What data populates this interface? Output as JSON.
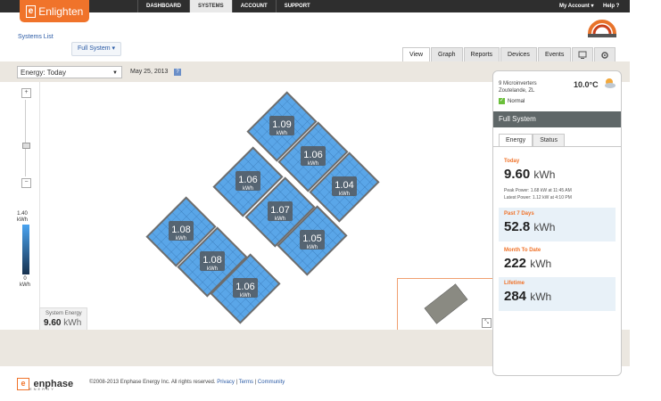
{
  "header": {
    "logo_text": "Enlighten",
    "logo_bracket": "e",
    "nav": [
      "DASHBOARD",
      "SYSTEMS",
      "ACCOUNT",
      "SUPPORT"
    ],
    "active_nav": "SYSTEMS",
    "my_account": "My Account ▾",
    "help": "Help ?"
  },
  "systems_list": "Systems List",
  "full_system_dropdown": "Full System ▾",
  "view_tabs": [
    "View",
    "Graph",
    "Reports",
    "Devices",
    "Events"
  ],
  "active_view_tab": "View",
  "toolbar": {
    "energy_select": "Energy: Today",
    "date": "May 25, 2013",
    "help_button": "?"
  },
  "scale": {
    "max": "1.40",
    "max_unit": "kWh",
    "min": "0",
    "min_unit": "kWh"
  },
  "panels": [
    {
      "value": "1.09",
      "unit": "kWh"
    },
    {
      "value": "1.06",
      "unit": "kWh"
    },
    {
      "value": "1.06",
      "unit": "kWh"
    },
    {
      "value": "1.04",
      "unit": "kWh"
    },
    {
      "value": "1.07",
      "unit": "kWh"
    },
    {
      "value": "1.08",
      "unit": "kWh"
    },
    {
      "value": "1.05",
      "unit": "kWh"
    },
    {
      "value": "1.08",
      "unit": "kWh"
    },
    {
      "value": "1.06",
      "unit": "kWh"
    }
  ],
  "system_energy": {
    "label": "System Energy",
    "value": "9.60",
    "unit": "kWh"
  },
  "sidebar": {
    "location_line1": "9 Microinverters",
    "location_line2": "Zoutelande, ZL",
    "temperature": "10.0°C",
    "status": "Normal",
    "title": "Full System",
    "tabs": [
      "Energy",
      "Status"
    ],
    "active_tab": "Energy",
    "cards": [
      {
        "label": "Today",
        "value": "9.60",
        "unit": "kWh",
        "peak": "Peak Power: 1.68 kW at 11:45 AM",
        "latest": "Latest Power: 1.12 kW at 4:10 PM"
      },
      {
        "label": "Past 7 Days",
        "value": "52.8",
        "unit": "kWh"
      },
      {
        "label": "Month To Date",
        "value": "222",
        "unit": "kWh"
      },
      {
        "label": "Lifetime",
        "value": "284",
        "unit": "kWh"
      }
    ]
  },
  "footer": {
    "brand": "enphase",
    "brand_sub": "ENERGY",
    "copyright": "©2008-2013 Enphase Energy Inc. All rights reserved.",
    "links": [
      "Privacy",
      "Terms",
      "Community"
    ]
  }
}
